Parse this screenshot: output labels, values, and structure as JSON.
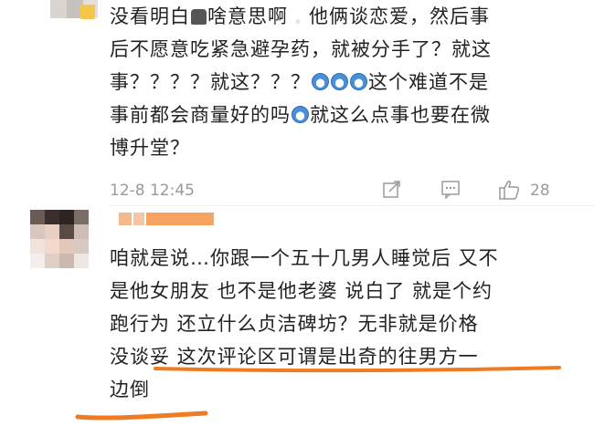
{
  "comments": [
    {
      "lines": [
        {
          "parts": [
            {
              "t": "没看明白"
            },
            {
              "icon": "ghost"
            },
            {
              "t": "啥意思啊"
            },
            {
              "blur": " . "
            },
            {
              "t": "他俩谈恋爱，然后事"
            }
          ]
        },
        {
          "parts": [
            {
              "t": "后不愿意吃紧急避孕药，就被分手了？就这"
            }
          ]
        },
        {
          "parts": [
            {
              "t": "事？？？？就这？？？"
            },
            {
              "icon": "emoji"
            },
            {
              "icon": "emoji"
            },
            {
              "icon": "emoji"
            },
            {
              "t": "这个难道不是"
            }
          ]
        },
        {
          "parts": [
            {
              "t": "事前都会商量好的吗"
            },
            {
              "icon": "emoji"
            },
            {
              "t": "就这么点事也要在微"
            }
          ]
        },
        {
          "parts": [
            {
              "t": "博升堂？"
            }
          ]
        }
      ],
      "time": "12-8 12:45",
      "likes": "28"
    },
    {
      "lines": [
        {
          "parts": [
            {
              "t": "咱就是说…你跟一个五十几男人睡觉后 又不"
            }
          ]
        },
        {
          "parts": [
            {
              "t": "是他女朋友 也不是他老婆 说白了 就是个约"
            }
          ]
        },
        {
          "parts": [
            {
              "t": "跑行为 还立什么贞洁碑坊？无非就是价格"
            }
          ]
        },
        {
          "parts": [
            {
              "t": "没谈妥 这次评论区可谓是出奇的往男方一"
            }
          ]
        },
        {
          "parts": [
            {
              "t": "边倒"
            }
          ]
        }
      ]
    }
  ],
  "colors": {
    "highlight": "#f07b21",
    "text": "#222222",
    "meta": "#9a9a9a"
  }
}
